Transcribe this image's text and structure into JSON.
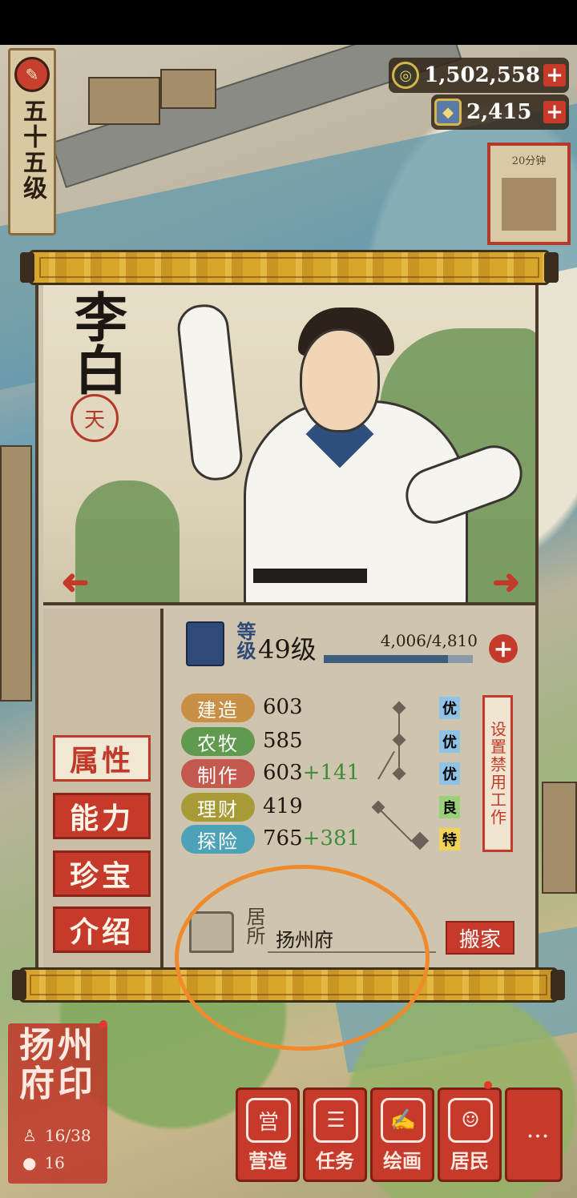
{
  "level_plaque": {
    "text": "五十五级",
    "emblem": "✎"
  },
  "currency": [
    {
      "name": "coin",
      "value": "1,502,558",
      "icon": "coin-icon",
      "glyph": "◎"
    },
    {
      "name": "gem",
      "value": "2,415",
      "icon": "gem-icon",
      "glyph": "◆"
    }
  ],
  "currency_plus": "+",
  "side_card": {
    "label": "20分钟"
  },
  "hero": {
    "name": "李白",
    "seal": "天",
    "level_label": "等级",
    "level": "49级",
    "xp_text": "4,006/4,810",
    "xp_progress": 0.832,
    "xp_plus": "+",
    "stats": [
      {
        "label": "建造",
        "value": "603",
        "bonus": "",
        "grade": "优",
        "color": "#c98f45",
        "grade_color": "#8fc3e6"
      },
      {
        "label": "农牧",
        "value": "585",
        "bonus": "",
        "grade": "优",
        "color": "#5f9a4e",
        "grade_color": "#8fc3e6"
      },
      {
        "label": "制作",
        "value": "603",
        "bonus": "+141",
        "grade": "优",
        "color": "#c45a4e",
        "grade_color": "#8fc3e6"
      },
      {
        "label": "理财",
        "value": "419",
        "bonus": "",
        "grade": "良",
        "color": "#a89a36",
        "grade_color": "#9ad07a"
      },
      {
        "label": "探险",
        "value": "765",
        "bonus": "+381",
        "grade": "特",
        "color": "#4ea2b8",
        "grade_color": "#f2d25a"
      }
    ],
    "ban_work": "设置禁用工作",
    "residence_label": "居所",
    "residence": "扬州府",
    "move_button": "搬家"
  },
  "tabs": [
    "属性",
    "能力",
    "珍宝",
    "介绍"
  ],
  "arrows": {
    "left": "➜",
    "right": "➜"
  },
  "seal_panel": {
    "title": "扬州府印",
    "stat1": "16/38",
    "stat2": "16"
  },
  "bottom_buttons": [
    {
      "label": "营造",
      "glyph": "営"
    },
    {
      "label": "任务",
      "glyph": "☰"
    },
    {
      "label": "绘画",
      "glyph": "✍"
    },
    {
      "label": "居民",
      "glyph": "☺"
    },
    {
      "label": "",
      "glyph": "···"
    }
  ]
}
